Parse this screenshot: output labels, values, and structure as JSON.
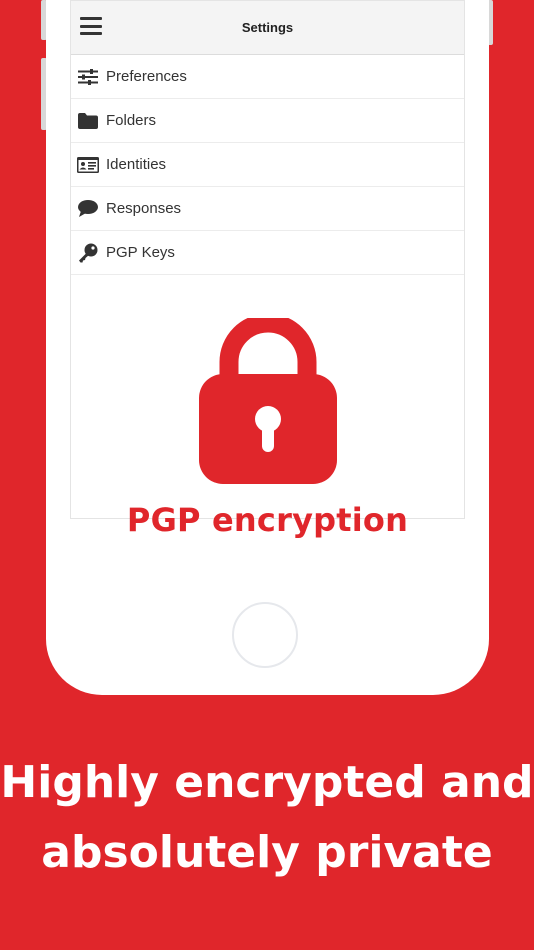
{
  "app_bar": {
    "title": "Settings",
    "menu_icon": "hamburger-icon"
  },
  "settings_menu": [
    {
      "label": "Preferences",
      "icon": "sliders-icon"
    },
    {
      "label": "Folders",
      "icon": "folder-icon"
    },
    {
      "label": "Identities",
      "icon": "id-card-icon"
    },
    {
      "label": "Responses",
      "icon": "speech-bubble-icon"
    },
    {
      "label": "PGP Keys",
      "icon": "key-icon"
    }
  ],
  "feature": {
    "icon": "padlock-icon",
    "caption": "PGP encryption"
  },
  "headline": {
    "line1": "Highly encrypted and",
    "line2": "absolutely private"
  },
  "colors": {
    "brand_red": "#e0262b",
    "background": "#e0262b",
    "phone_body": "#ffffff",
    "text_dark": "#333333"
  }
}
